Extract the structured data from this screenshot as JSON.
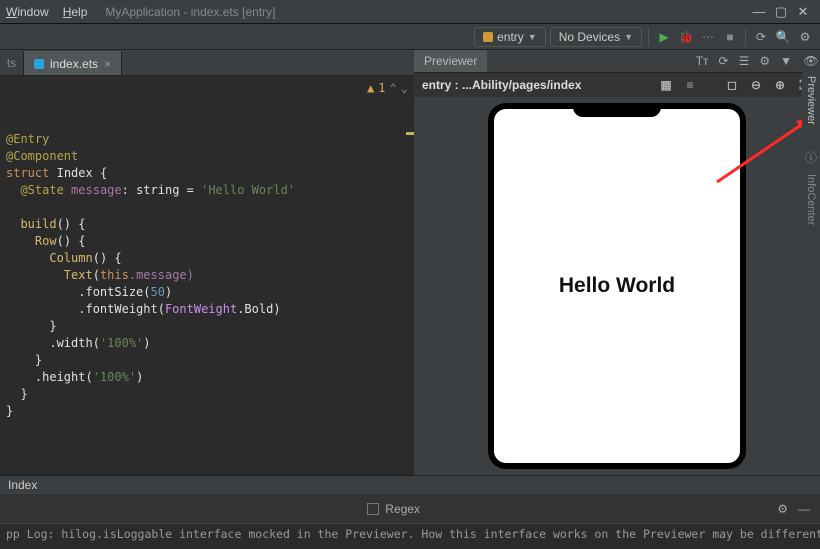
{
  "menubar": {
    "window": "Window",
    "help": "Help"
  },
  "app_title": "MyApplication - index.ets [entry]",
  "window_controls": {
    "min": "—",
    "max": "▢",
    "close": "✕"
  },
  "toolbar": {
    "module_selector": "entry",
    "device_selector": "No Devices"
  },
  "editor_tab": {
    "filename": "index.ets"
  },
  "gutter": {
    "warning_count": "1"
  },
  "code": {
    "l1_ann": "@Entry",
    "l2_ann": "@Component",
    "l3_a": "struct",
    "l3_b": "Index {",
    "l4_a": "@State",
    "l4_b": "message",
    "l4_c": ": string = ",
    "l4_d": "'Hello World'",
    "l6_a": "build",
    "l6_b": "() {",
    "l7_a": "Row",
    "l7_b": "() {",
    "l8_a": "Column",
    "l8_b": "() {",
    "l9_a": "Text",
    "l9_b": "(",
    "l9_c": "this",
    "l9_d": ".message)",
    "l10_a": ".fontSize(",
    "l10_b": "50",
    "l10_c": ")",
    "l11_a": ".fontWeight(",
    "l11_b": "FontWeight",
    "l11_c": ".Bold)",
    "l12": "}",
    "l13_a": ".width(",
    "l13_b": "'100%'",
    "l13_c": ")",
    "l14": "}",
    "l15_a": ".height(",
    "l15_b": "'100%'",
    "l15_c": ")",
    "l16": "}",
    "l17": "}"
  },
  "previewer": {
    "tab_label": "Previewer",
    "path_label": "entry : ...Ability/pages/index",
    "device_text": "Hello World"
  },
  "side_rail": {
    "previewer": "Previewer",
    "infocenter": "InfoCenter"
  },
  "indexbar": {
    "label": "Index"
  },
  "findbar": {
    "regex_label": "Regex"
  },
  "log": {
    "line": "pp Log: hilog.isLoggable interface mocked in the Previewer. How this interface works on the Previewer may be different from that on"
  }
}
